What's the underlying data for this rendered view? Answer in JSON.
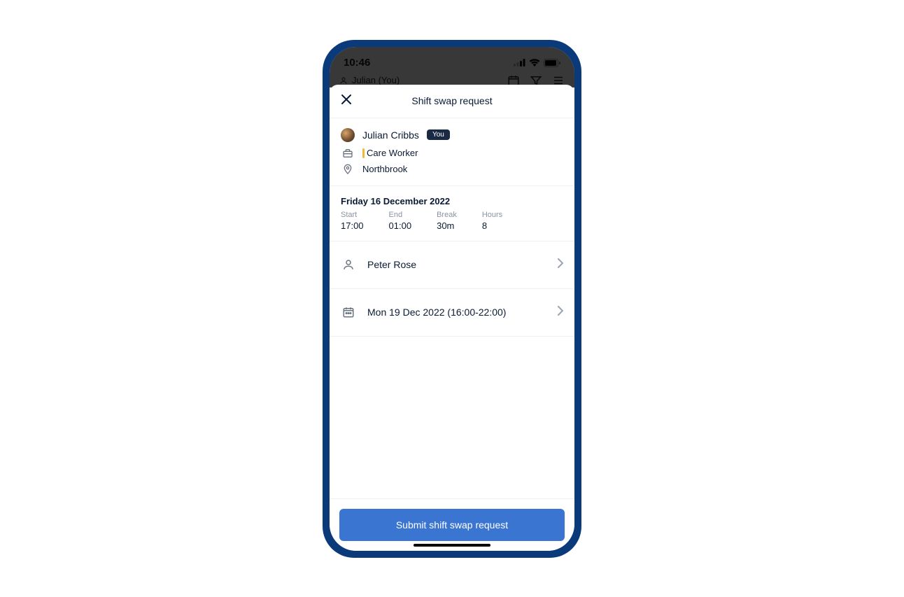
{
  "statusbar": {
    "time": "10:46"
  },
  "behind": {
    "user_label": "Julian (You)"
  },
  "modal": {
    "title": "Shift swap request"
  },
  "requester": {
    "name": "Julian Cribbs",
    "you_badge": "You",
    "role": "Care Worker",
    "location": "Northbrook"
  },
  "shift": {
    "date": "Friday 16 December 2022",
    "start_label": "Start",
    "start_value": "17:00",
    "end_label": "End",
    "end_value": "01:00",
    "break_label": "Break",
    "break_value": "30m",
    "hours_label": "Hours",
    "hours_value": "8"
  },
  "swap_target": {
    "person": "Peter Rose",
    "shift_text": "Mon 19 Dec 2022 (16:00-22:00)"
  },
  "footer": {
    "submit_label": "Submit shift swap request"
  }
}
